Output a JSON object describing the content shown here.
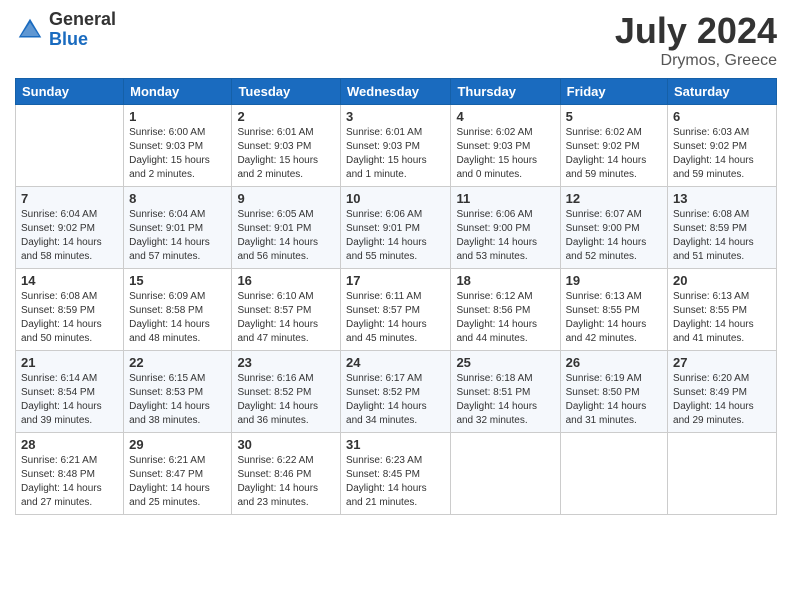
{
  "logo": {
    "general": "General",
    "blue": "Blue"
  },
  "title": {
    "month": "July 2024",
    "location": "Drymos, Greece"
  },
  "weekdays": [
    "Sunday",
    "Monday",
    "Tuesday",
    "Wednesday",
    "Thursday",
    "Friday",
    "Saturday"
  ],
  "weeks": [
    [
      {
        "day": "",
        "sunrise": "",
        "sunset": "",
        "daylight": ""
      },
      {
        "day": "1",
        "sunrise": "Sunrise: 6:00 AM",
        "sunset": "Sunset: 9:03 PM",
        "daylight": "Daylight: 15 hours and 2 minutes."
      },
      {
        "day": "2",
        "sunrise": "Sunrise: 6:01 AM",
        "sunset": "Sunset: 9:03 PM",
        "daylight": "Daylight: 15 hours and 2 minutes."
      },
      {
        "day": "3",
        "sunrise": "Sunrise: 6:01 AM",
        "sunset": "Sunset: 9:03 PM",
        "daylight": "Daylight: 15 hours and 1 minute."
      },
      {
        "day": "4",
        "sunrise": "Sunrise: 6:02 AM",
        "sunset": "Sunset: 9:03 PM",
        "daylight": "Daylight: 15 hours and 0 minutes."
      },
      {
        "day": "5",
        "sunrise": "Sunrise: 6:02 AM",
        "sunset": "Sunset: 9:02 PM",
        "daylight": "Daylight: 14 hours and 59 minutes."
      },
      {
        "day": "6",
        "sunrise": "Sunrise: 6:03 AM",
        "sunset": "Sunset: 9:02 PM",
        "daylight": "Daylight: 14 hours and 59 minutes."
      }
    ],
    [
      {
        "day": "7",
        "sunrise": "Sunrise: 6:04 AM",
        "sunset": "Sunset: 9:02 PM",
        "daylight": "Daylight: 14 hours and 58 minutes."
      },
      {
        "day": "8",
        "sunrise": "Sunrise: 6:04 AM",
        "sunset": "Sunset: 9:01 PM",
        "daylight": "Daylight: 14 hours and 57 minutes."
      },
      {
        "day": "9",
        "sunrise": "Sunrise: 6:05 AM",
        "sunset": "Sunset: 9:01 PM",
        "daylight": "Daylight: 14 hours and 56 minutes."
      },
      {
        "day": "10",
        "sunrise": "Sunrise: 6:06 AM",
        "sunset": "Sunset: 9:01 PM",
        "daylight": "Daylight: 14 hours and 55 minutes."
      },
      {
        "day": "11",
        "sunrise": "Sunrise: 6:06 AM",
        "sunset": "Sunset: 9:00 PM",
        "daylight": "Daylight: 14 hours and 53 minutes."
      },
      {
        "day": "12",
        "sunrise": "Sunrise: 6:07 AM",
        "sunset": "Sunset: 9:00 PM",
        "daylight": "Daylight: 14 hours and 52 minutes."
      },
      {
        "day": "13",
        "sunrise": "Sunrise: 6:08 AM",
        "sunset": "Sunset: 8:59 PM",
        "daylight": "Daylight: 14 hours and 51 minutes."
      }
    ],
    [
      {
        "day": "14",
        "sunrise": "Sunrise: 6:08 AM",
        "sunset": "Sunset: 8:59 PM",
        "daylight": "Daylight: 14 hours and 50 minutes."
      },
      {
        "day": "15",
        "sunrise": "Sunrise: 6:09 AM",
        "sunset": "Sunset: 8:58 PM",
        "daylight": "Daylight: 14 hours and 48 minutes."
      },
      {
        "day": "16",
        "sunrise": "Sunrise: 6:10 AM",
        "sunset": "Sunset: 8:57 PM",
        "daylight": "Daylight: 14 hours and 47 minutes."
      },
      {
        "day": "17",
        "sunrise": "Sunrise: 6:11 AM",
        "sunset": "Sunset: 8:57 PM",
        "daylight": "Daylight: 14 hours and 45 minutes."
      },
      {
        "day": "18",
        "sunrise": "Sunrise: 6:12 AM",
        "sunset": "Sunset: 8:56 PM",
        "daylight": "Daylight: 14 hours and 44 minutes."
      },
      {
        "day": "19",
        "sunrise": "Sunrise: 6:13 AM",
        "sunset": "Sunset: 8:55 PM",
        "daylight": "Daylight: 14 hours and 42 minutes."
      },
      {
        "day": "20",
        "sunrise": "Sunrise: 6:13 AM",
        "sunset": "Sunset: 8:55 PM",
        "daylight": "Daylight: 14 hours and 41 minutes."
      }
    ],
    [
      {
        "day": "21",
        "sunrise": "Sunrise: 6:14 AM",
        "sunset": "Sunset: 8:54 PM",
        "daylight": "Daylight: 14 hours and 39 minutes."
      },
      {
        "day": "22",
        "sunrise": "Sunrise: 6:15 AM",
        "sunset": "Sunset: 8:53 PM",
        "daylight": "Daylight: 14 hours and 38 minutes."
      },
      {
        "day": "23",
        "sunrise": "Sunrise: 6:16 AM",
        "sunset": "Sunset: 8:52 PM",
        "daylight": "Daylight: 14 hours and 36 minutes."
      },
      {
        "day": "24",
        "sunrise": "Sunrise: 6:17 AM",
        "sunset": "Sunset: 8:52 PM",
        "daylight": "Daylight: 14 hours and 34 minutes."
      },
      {
        "day": "25",
        "sunrise": "Sunrise: 6:18 AM",
        "sunset": "Sunset: 8:51 PM",
        "daylight": "Daylight: 14 hours and 32 minutes."
      },
      {
        "day": "26",
        "sunrise": "Sunrise: 6:19 AM",
        "sunset": "Sunset: 8:50 PM",
        "daylight": "Daylight: 14 hours and 31 minutes."
      },
      {
        "day": "27",
        "sunrise": "Sunrise: 6:20 AM",
        "sunset": "Sunset: 8:49 PM",
        "daylight": "Daylight: 14 hours and 29 minutes."
      }
    ],
    [
      {
        "day": "28",
        "sunrise": "Sunrise: 6:21 AM",
        "sunset": "Sunset: 8:48 PM",
        "daylight": "Daylight: 14 hours and 27 minutes."
      },
      {
        "day": "29",
        "sunrise": "Sunrise: 6:21 AM",
        "sunset": "Sunset: 8:47 PM",
        "daylight": "Daylight: 14 hours and 25 minutes."
      },
      {
        "day": "30",
        "sunrise": "Sunrise: 6:22 AM",
        "sunset": "Sunset: 8:46 PM",
        "daylight": "Daylight: 14 hours and 23 minutes."
      },
      {
        "day": "31",
        "sunrise": "Sunrise: 6:23 AM",
        "sunset": "Sunset: 8:45 PM",
        "daylight": "Daylight: 14 hours and 21 minutes."
      },
      {
        "day": "",
        "sunrise": "",
        "sunset": "",
        "daylight": ""
      },
      {
        "day": "",
        "sunrise": "",
        "sunset": "",
        "daylight": ""
      },
      {
        "day": "",
        "sunrise": "",
        "sunset": "",
        "daylight": ""
      }
    ]
  ]
}
